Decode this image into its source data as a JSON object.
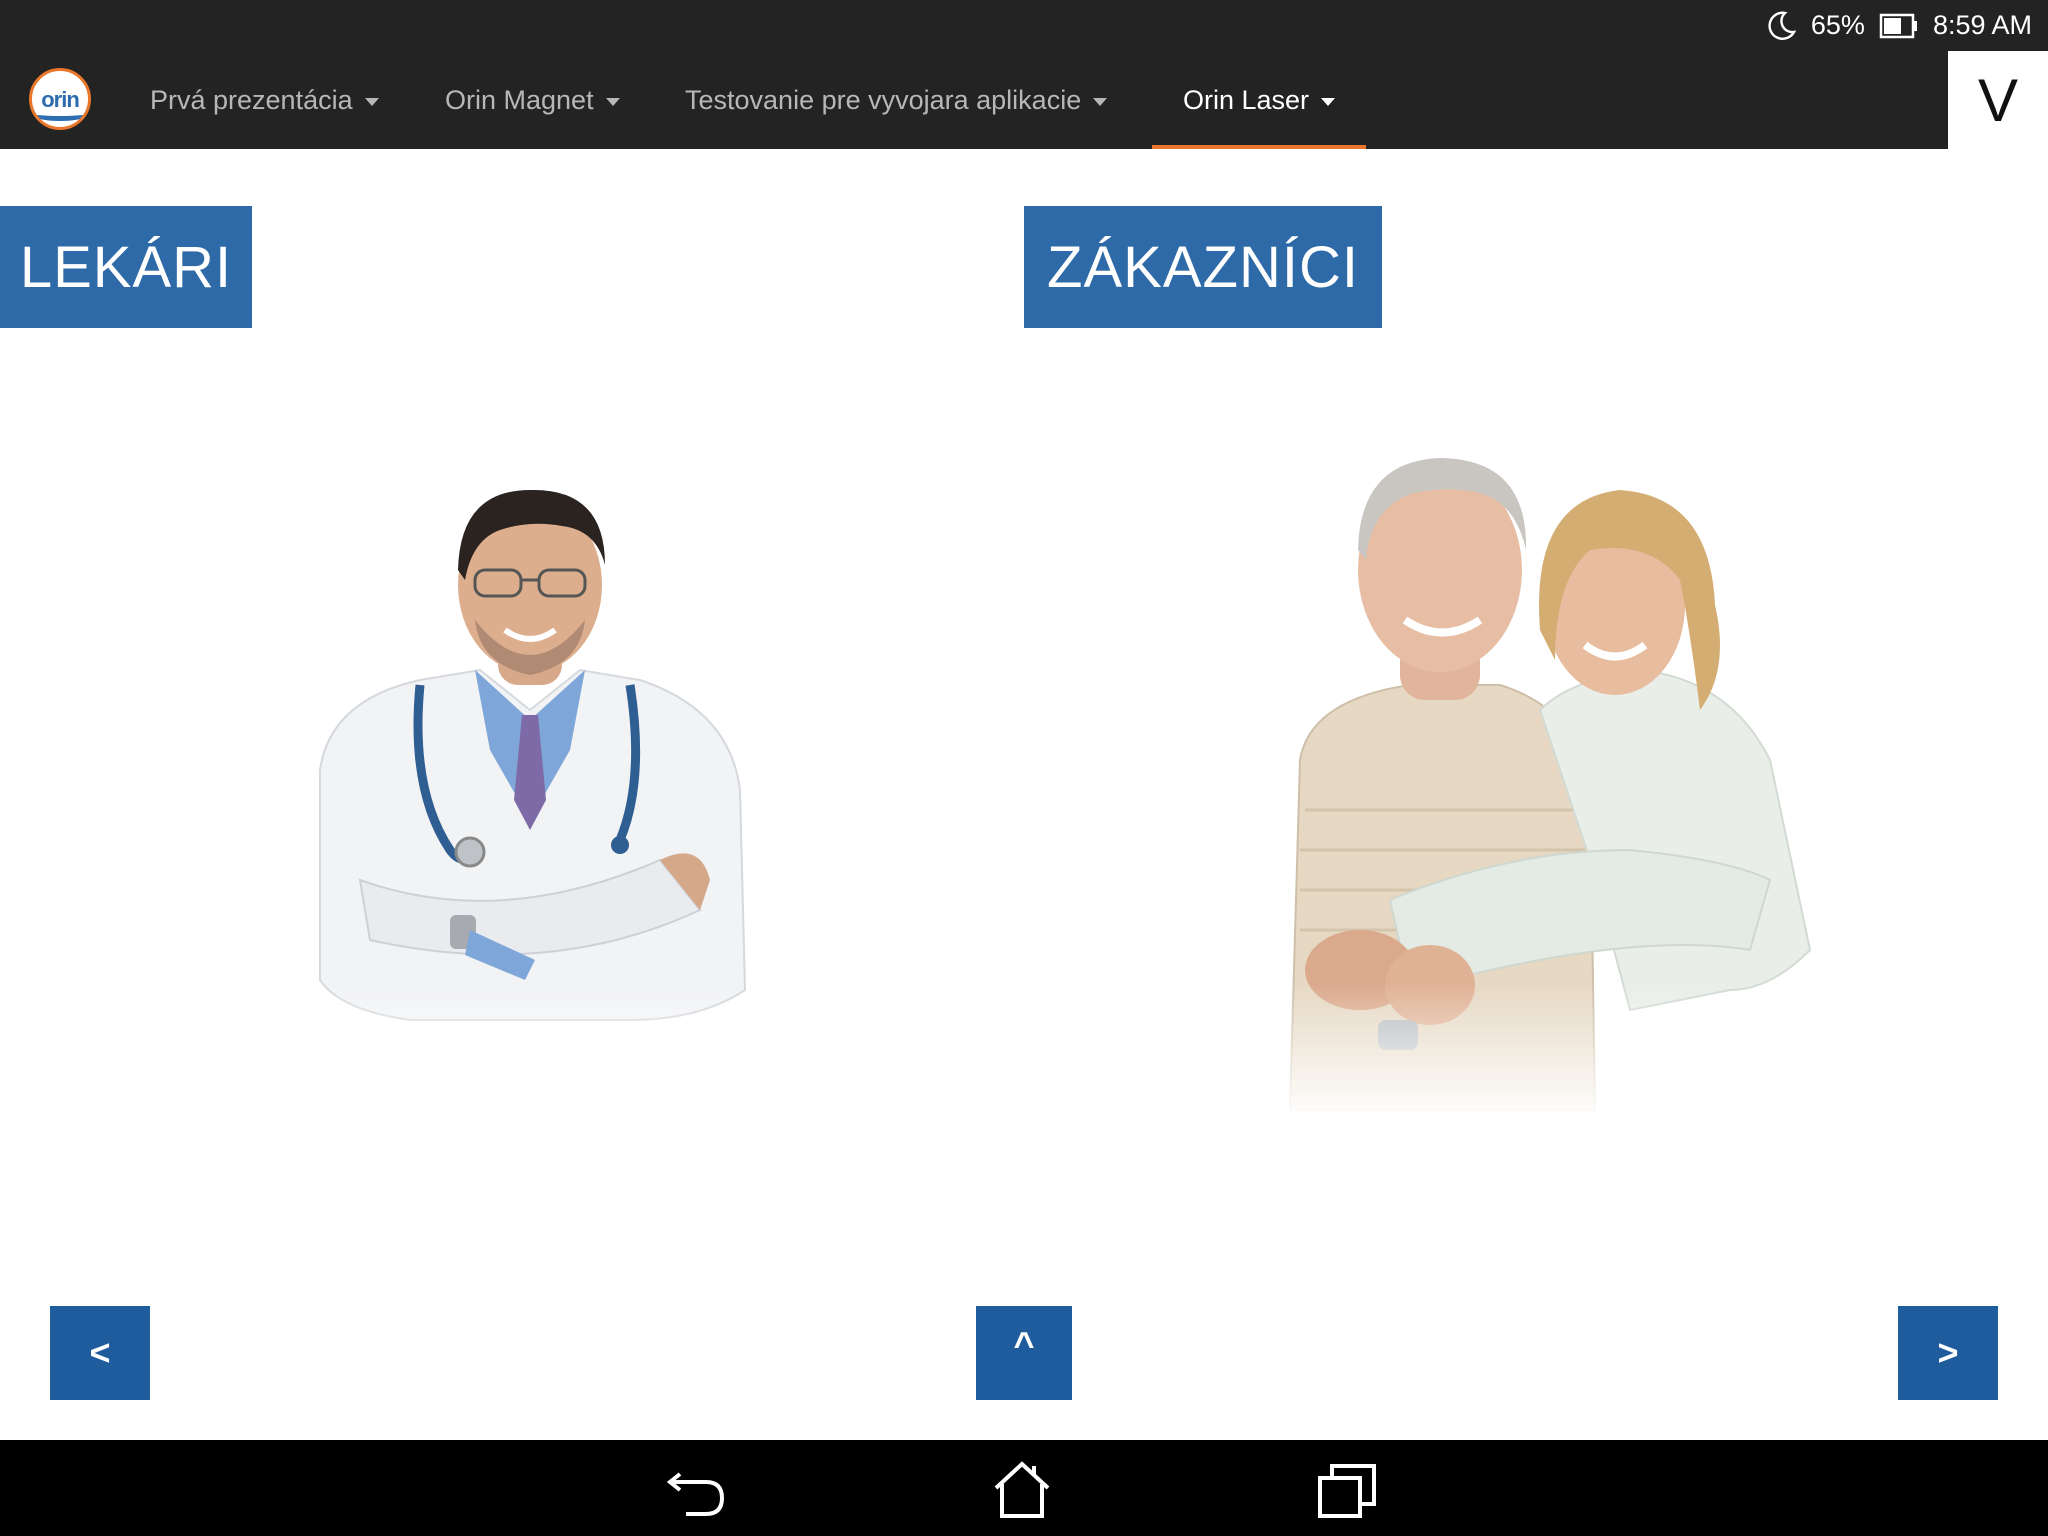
{
  "status_bar": {
    "battery": "65%",
    "time": "8:59 AM",
    "icons": [
      "moon-icon",
      "battery-icon"
    ]
  },
  "nav": {
    "logo_text": "orin",
    "items": [
      {
        "label": "Prvá prezentácia"
      },
      {
        "label": "Orin Magnet"
      },
      {
        "label": "Testovanie pre vyvojara aplikacie"
      },
      {
        "label": "Orin Laser"
      }
    ],
    "active_item": "Orin Laser",
    "side_toggle": "V"
  },
  "content": {
    "left_label": "LEKÁRI",
    "right_label": "ZÁKAZNÍCI"
  },
  "buttons": {
    "prev": "<",
    "up": "^",
    "next": ">"
  },
  "colors": {
    "bar_bg": "#232323",
    "label_blue": "#2e6aa8",
    "button_blue": "#1f5c9d",
    "accent_orange": "#e9772b"
  },
  "system_bar": {
    "icons": [
      "back-icon",
      "home-icon",
      "recents-icon"
    ]
  }
}
